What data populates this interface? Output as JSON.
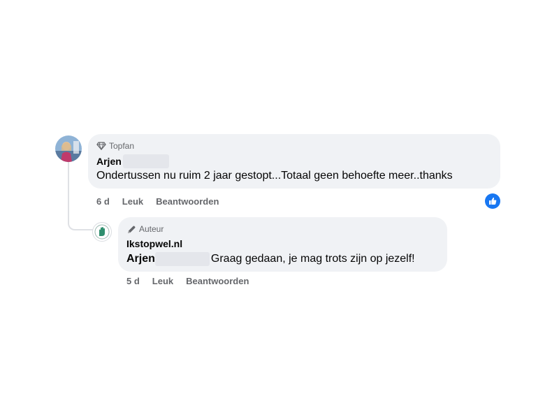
{
  "comment1": {
    "badge": "Topfan",
    "author": "Arjen",
    "text": "Ondertussen nu ruim 2 jaar gestopt...Totaal geen behoefte meer..thanks",
    "time": "6 d",
    "like_label": "Leuk",
    "reply_label": "Beantwoorden",
    "reaction_icon": "thumbs-up-icon",
    "reaction_color": "#1877f2"
  },
  "reply": {
    "badge": "Auteur",
    "author": "Ikstopwel.nl",
    "mention": "Arjen",
    "text": "Graag gedaan, je mag trots zijn op jezelf!",
    "time": "5 d",
    "like_label": "Leuk",
    "reply_label": "Beantwoorden"
  },
  "colors": {
    "bubble": "#f0f2f5",
    "secondary_text": "#65676b",
    "accent": "#1877f2"
  }
}
